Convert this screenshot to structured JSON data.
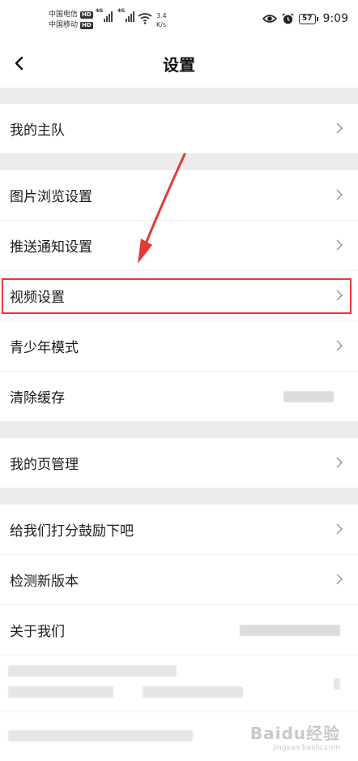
{
  "status_bar": {
    "carrier1": "中国电信",
    "carrier2": "中国移动",
    "hd": "HD",
    "network": "4G",
    "speed_value": "3.4",
    "speed_unit": "K/s",
    "battery": "57",
    "time": "9:09"
  },
  "nav": {
    "title": "设置"
  },
  "sections": [
    {
      "items": [
        {
          "label": "我的主队"
        }
      ]
    },
    {
      "items": [
        {
          "label": "图片浏览设置"
        },
        {
          "label": "推送通知设置"
        },
        {
          "label": "视频设置"
        },
        {
          "label": "青少年模式"
        },
        {
          "label": "清除缓存"
        }
      ]
    },
    {
      "items": [
        {
          "label": "我的页管理"
        }
      ]
    },
    {
      "items": [
        {
          "label": "给我们打分鼓励下吧"
        },
        {
          "label": "检测新版本"
        },
        {
          "label": "关于我们"
        }
      ]
    }
  ],
  "watermark": {
    "brand": "Baidu经验",
    "url": "jingyan.baidu.com"
  },
  "colors": {
    "highlight": "#e53935",
    "section_gap": "#ececec"
  }
}
